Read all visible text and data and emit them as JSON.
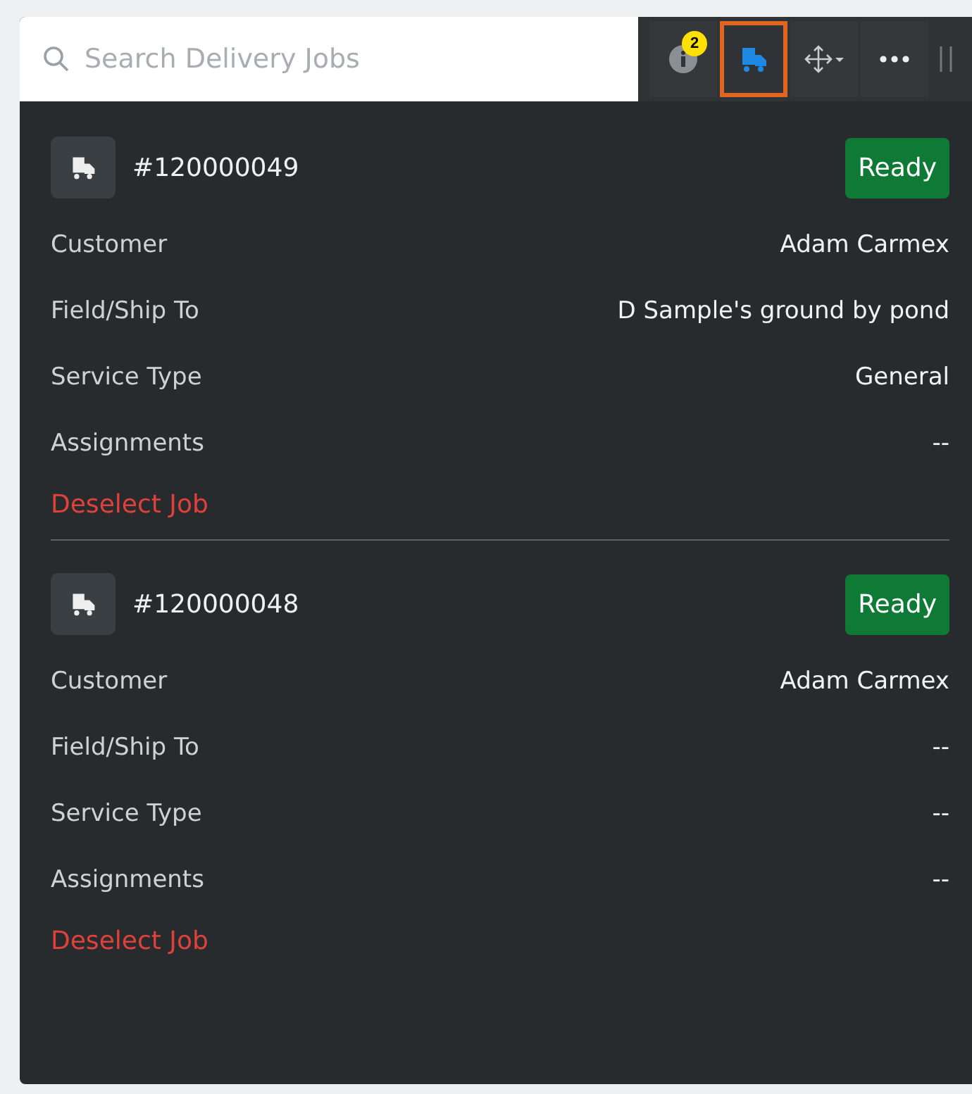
{
  "search": {
    "placeholder": "Search Delivery Jobs"
  },
  "toolbar": [
    {
      "kind": "info",
      "badge": "2",
      "selected": false
    },
    {
      "kind": "truck",
      "selected": true
    },
    {
      "kind": "move",
      "selected": false
    },
    {
      "kind": "more",
      "selected": false
    }
  ],
  "jobs": [
    {
      "number": "#120000049",
      "status": "Ready",
      "fields": [
        {
          "label": "Customer",
          "value": "Adam Carmex"
        },
        {
          "label": "Field/Ship To",
          "value": "D Sample's ground by pond"
        },
        {
          "label": "Service Type",
          "value": "General"
        },
        {
          "label": "Assignments",
          "value": "--"
        }
      ],
      "action": "Deselect Job"
    },
    {
      "number": "#120000048",
      "status": "Ready",
      "fields": [
        {
          "label": "Customer",
          "value": "Adam Carmex"
        },
        {
          "label": "Field/Ship To",
          "value": "--"
        },
        {
          "label": "Service Type",
          "value": "--"
        },
        {
          "label": "Assignments",
          "value": "--"
        }
      ],
      "action": "Deselect Job"
    }
  ]
}
